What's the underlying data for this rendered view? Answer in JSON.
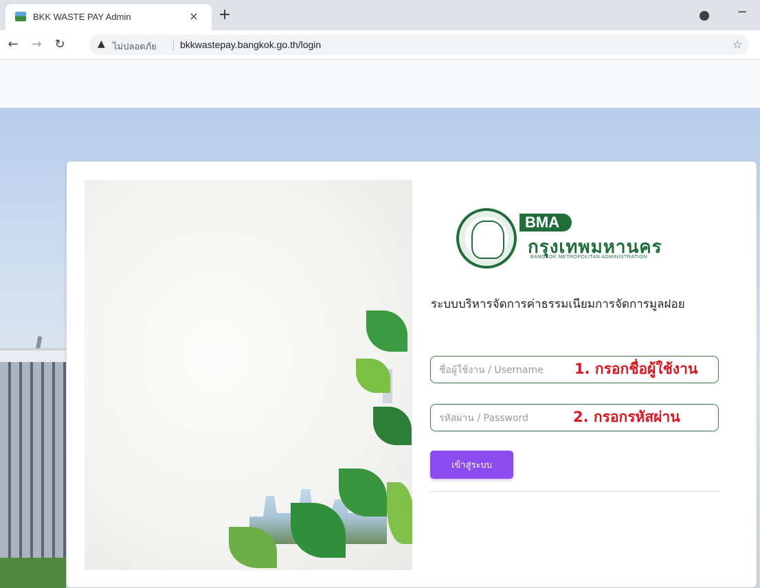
{
  "browser": {
    "tab_title": "BKK WASTE PAY Admin",
    "tab_close": "×",
    "new_tab": "+",
    "insecure_label": "ไม่ปลอดภัย",
    "url": "bkkwastepay.bangkok.go.th/login"
  },
  "logo": {
    "abbr": "BMA",
    "thai_name": "กรุงเทพมหานคร",
    "english_name": "BANGKOK METROPOLITAN ADMINISTRATION"
  },
  "login": {
    "system_title": "ระบบบริหารจัดการค่าธรรมเนียมการจัดการมูลฝอย",
    "username_placeholder": "ชื่อผู้ใช้งาน / Username",
    "password_placeholder": "รหัสผ่าน / Password",
    "submit_label": "เข้าสู่ระบบ"
  },
  "annotations": {
    "step1": "1. กรอกชื่อผู้ใช้งาน",
    "step2": "2. กรอกรหัสผ่าน"
  },
  "colors": {
    "accent_button": "#8b4cf0",
    "brand_green": "#1f6e3a",
    "annotation_red": "#e0141e"
  }
}
